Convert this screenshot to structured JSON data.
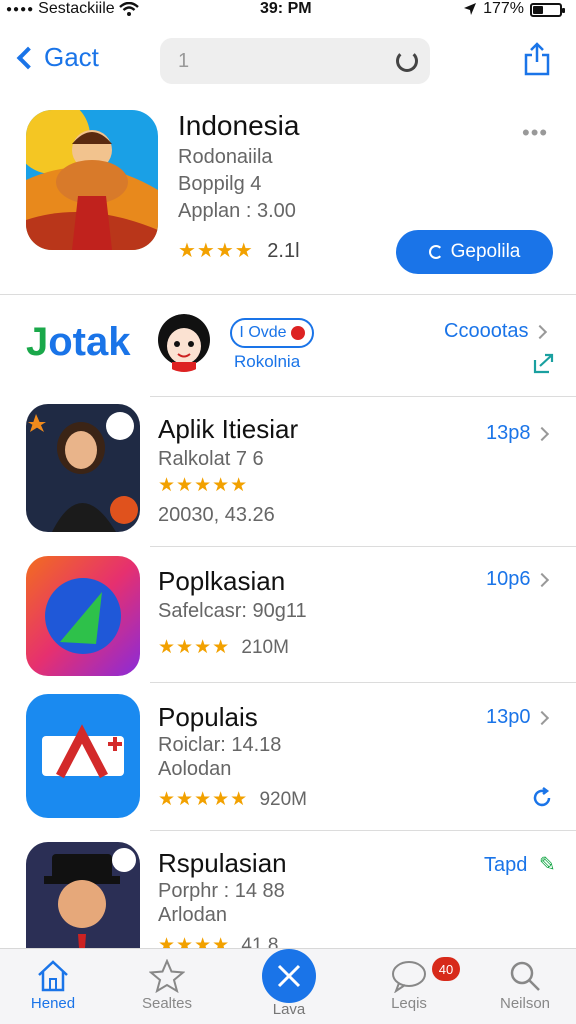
{
  "status_bar": {
    "carrier": "Sestackiile",
    "time": "39: PM",
    "battery": "177%"
  },
  "nav": {
    "back_label": "Gact",
    "search_value": "1"
  },
  "featured": {
    "title": "Indonesia",
    "line1": "Rodonaiila",
    "line2": "Boppilg 4",
    "line3": "Applan : 3.00",
    "stars": "★★★★",
    "rating_value": "2.1l",
    "get_label": "Gepolila"
  },
  "brand": {
    "logo_text_1": "J",
    "logo_text_2": "otak",
    "pill_label": "I Ovde",
    "sub_label": "Rokolnia",
    "link_label": "Ccoootas"
  },
  "apps": [
    {
      "name": "Aplik Itiesiar",
      "meta1": "Ralkolat 7 6",
      "stars": "★★★★★",
      "meta2": "20030, 43.26",
      "link": "13p8"
    },
    {
      "name": "Poplkasian",
      "meta1": "Safelcasr: 90g11",
      "stars": "★★★★",
      "meta2": "210M",
      "link": "10p6"
    },
    {
      "name": "Populais",
      "meta1": "Roiclar: 14.18",
      "meta1b": "Aolodan",
      "stars": "★★★★★",
      "meta2": "920M",
      "link": "13p0"
    },
    {
      "name": "Rspulasian",
      "meta1": "Porphr : 14 88",
      "meta1b": "Arlodan",
      "stars": "★★★★",
      "meta2": "41.8",
      "link": "Tapd"
    }
  ],
  "tabs": {
    "home": "Hened",
    "favorites": "Sealtes",
    "center": "Lava",
    "messages": "Leqis",
    "search": "Neilson",
    "badge": "40"
  },
  "colors": {
    "accent": "#1a74e8",
    "star": "#f2a100",
    "badge": "#d72a1a"
  }
}
